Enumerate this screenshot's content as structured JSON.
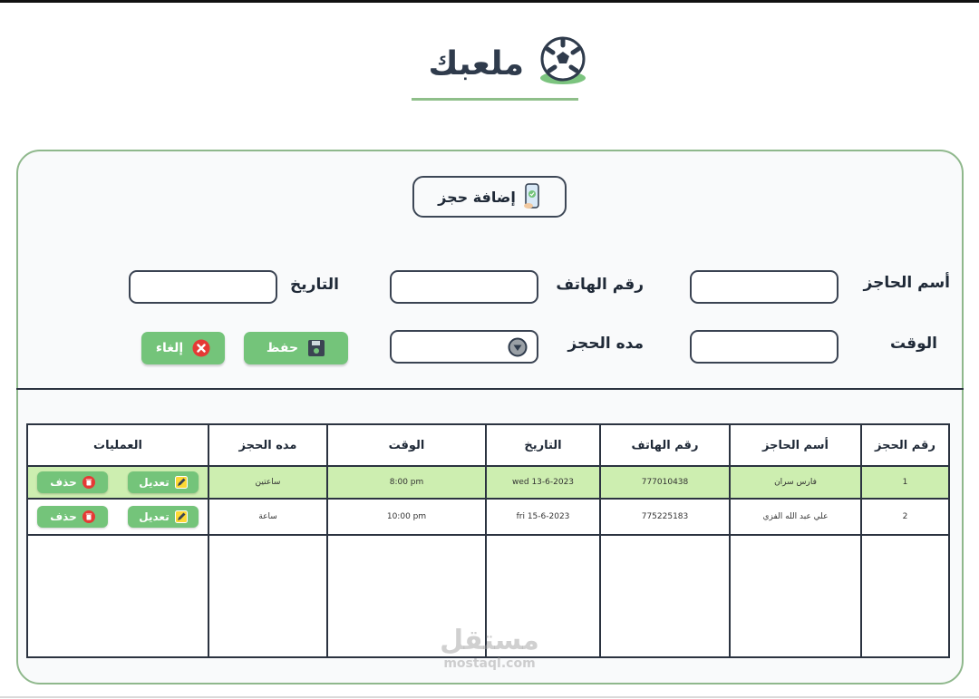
{
  "header": {
    "logo_text": "ملعبك",
    "logo_icon": "soccer-ball-icon"
  },
  "form": {
    "title": "إضافة حجز",
    "title_icon": "phone-check-icon",
    "labels": {
      "name": "أسم الحاجز",
      "phone": "رقم الهاتف",
      "date": "التاريخ",
      "time": "الوقت",
      "duration": "مده الحجز"
    },
    "values": {
      "name": "",
      "phone": "",
      "date": "",
      "time": "",
      "duration": ""
    },
    "buttons": {
      "save": "حفظ",
      "cancel": "إلغاء"
    }
  },
  "table": {
    "headers": [
      "رقم الحجز",
      "أسم الحاجز",
      "رقم الهاتف",
      "التاريخ",
      "الوقت",
      "مده الحجز",
      "العمليات"
    ],
    "rows": [
      {
        "id": "1",
        "name": "فارس سران",
        "phone": "777010438",
        "date": "wed  13-6-2023",
        "time": "8:00 pm",
        "duration": "ساعتين",
        "edit": "تعديل",
        "delete": "حذف"
      },
      {
        "id": "2",
        "name": "علي عبد الله الفزي",
        "phone": "775225183",
        "date": "fri  15-6-2023",
        "time": "10:00 pm",
        "duration": "ساعة",
        "edit": "تعديل",
        "delete": "حذف"
      }
    ]
  },
  "watermark": {
    "arabic": "مستقل",
    "latin": "mostaql.com"
  },
  "colors": {
    "accent_green": "#74c47a",
    "row_highlight": "#cdeeb0",
    "card_border": "#8fb88c",
    "delete_red": "#e53935"
  }
}
